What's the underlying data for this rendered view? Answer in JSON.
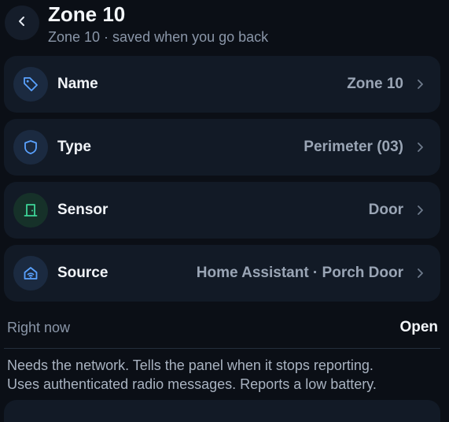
{
  "header": {
    "title": "Zone 10",
    "subtitle": "Zone 10 · saved when you go back",
    "back_icon": "chevron-left-icon"
  },
  "rows": [
    {
      "label": "Name",
      "value": "Zone 10",
      "icon": "tag-icon",
      "icon_color": "#5aa2ff"
    },
    {
      "label": "Type",
      "value": "Perimeter (03)",
      "icon": "shield-icon",
      "icon_color": "#5aa2ff"
    },
    {
      "label": "Sensor",
      "value": "Door",
      "icon": "door-icon",
      "icon_color": "#3ed598"
    },
    {
      "label": "Source",
      "value": "Home Assistant · Porch Door",
      "icon": "home-wifi-icon",
      "icon_color": "#5aa2ff"
    }
  ],
  "status": {
    "label": "Right now",
    "value": "Open"
  },
  "description": {
    "line1": "Needs the network. Tells the panel when it stops reporting.",
    "line2": "Uses authenticated radio messages. Reports a low battery."
  },
  "colors": {
    "background": "#0b0f16",
    "card": "#121a26",
    "accent_blue": "#5aa2ff",
    "accent_green": "#3ed598"
  }
}
